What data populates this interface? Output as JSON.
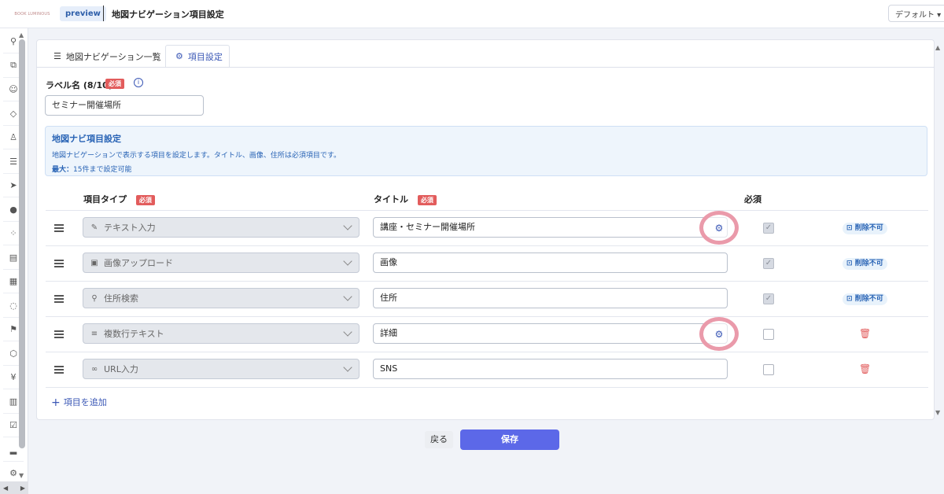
{
  "header": {
    "logo_text": "BOOK LUMINOUS",
    "preview_badge": "preview",
    "page_title": "地図ナビゲーション項目設定",
    "view_select": "デフォルト ▾"
  },
  "rail": {
    "icons": [
      "link-icon",
      "tag-icon",
      "smile-icon",
      "ticket-icon",
      "user-icon",
      "stack-icon",
      "send-icon",
      "chat-icon",
      "network-icon",
      "list-icon",
      "document-icon",
      "bubble-icon",
      "pin-icon",
      "box-icon",
      "yen-icon",
      "building-icon",
      "check-icon",
      "chart-icon",
      "gear-icon"
    ],
    "icon_glyphs": [
      "⚲",
      "⧉",
      "☺",
      "◇",
      "♙",
      "☰",
      "➤",
      "●",
      "⁘",
      "▤",
      "▦",
      "◌",
      "⚑",
      "⬡",
      "¥",
      "▥",
      "☑",
      "▂",
      "⚙"
    ]
  },
  "tabs": [
    {
      "label": "地図ナビゲーション一覧",
      "icon": "list-icon",
      "glyph": "☰"
    },
    {
      "label": "項目設定",
      "icon": "gear-icon",
      "glyph": "⚙"
    }
  ],
  "label_field": {
    "label": "ラベル名 (8/10)",
    "required": "必須",
    "info_glyph": "i",
    "value": "セミナー開催場所"
  },
  "info_box": {
    "title": "地図ナビ項目設定",
    "description": "地図ナビゲーションで表示する項目を設定します。タイトル、画像、住所は必須項目です。",
    "max_label": "最大：",
    "max_value": "15件まで設定可能"
  },
  "columns": {
    "type": "項目タイプ",
    "title": "タイトル",
    "required": "必須",
    "required_badge": "必須"
  },
  "rows": [
    {
      "type": "テキスト入力",
      "type_icon": "pencil-icon",
      "type_glyph": "✎",
      "title": "講座・セミナー開催場所",
      "has_gear": true,
      "required_checked": true,
      "action": "削除不可"
    },
    {
      "type": "画像アップロード",
      "type_icon": "image-icon",
      "type_glyph": "▣",
      "title": "画像",
      "has_gear": false,
      "required_checked": true,
      "action": "削除不可"
    },
    {
      "type": "住所検索",
      "type_icon": "pin-icon",
      "type_glyph": "⚲",
      "title": "住所",
      "has_gear": false,
      "required_checked": true,
      "action": "削除不可"
    },
    {
      "type": "複数行テキスト",
      "type_icon": "multiline-icon",
      "type_glyph": "≡",
      "title": "詳細",
      "has_gear": true,
      "required_checked": false,
      "action": "trash"
    },
    {
      "type": "URL入力",
      "type_icon": "link-icon",
      "type_glyph": "∞",
      "title": "SNS",
      "has_gear": false,
      "required_checked": false,
      "action": "trash"
    }
  ],
  "glyphs": {
    "gear": "⚙",
    "check": "✓",
    "lock": "🔒",
    "trash": "🗑",
    "plus": "+"
  },
  "add_button": "項目を追加",
  "footer": {
    "back": "戻る",
    "save": "保存"
  },
  "colors": {
    "accent": "#5c68e8",
    "required": "#e25c5c",
    "info_bg": "#eef5fc",
    "highlight_ring": "#ea9aaa"
  }
}
